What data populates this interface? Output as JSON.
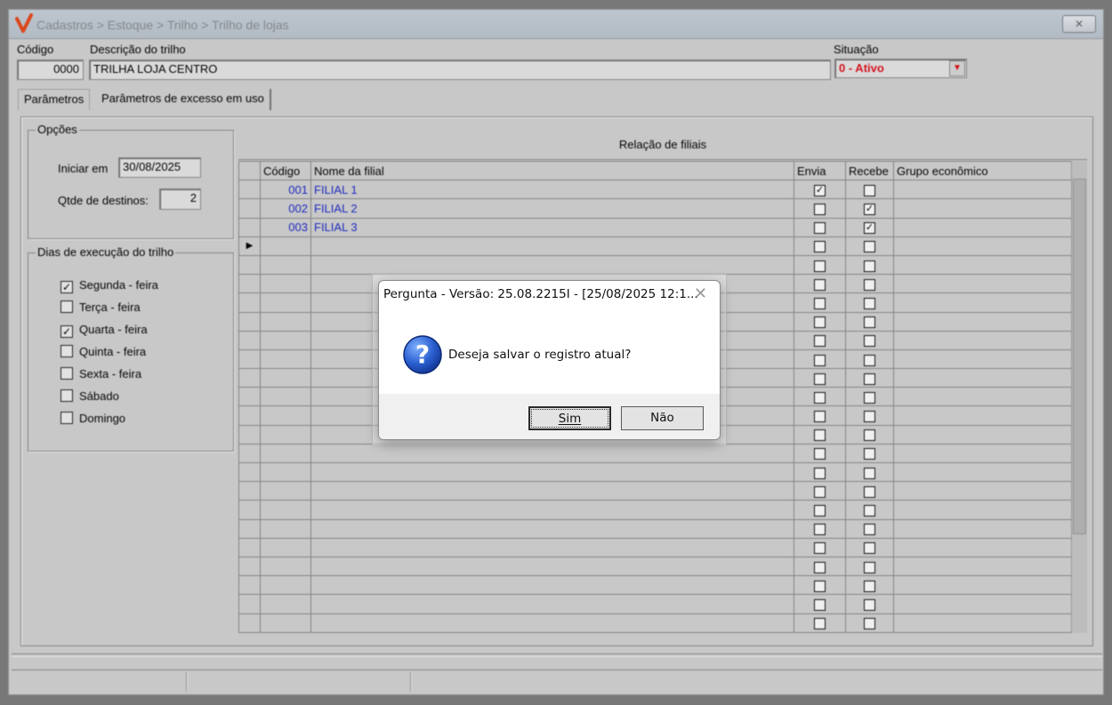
{
  "window": {
    "breadcrumb": "Cadastros > Estoque > Trilho > Trilho de lojas",
    "close_label": "✕"
  },
  "header": {
    "codigo_label": "Código",
    "codigo_value": "0000",
    "descricao_label": "Descrição do trilho",
    "descricao_value": "TRILHA LOJA CENTRO",
    "situacao_label": "Situação",
    "situacao_value": "0 - Ativo"
  },
  "tabs": [
    {
      "label": "Parâmetros"
    },
    {
      "label": "Parâmetros de excesso em uso"
    }
  ],
  "opcoes": {
    "title": "Opções",
    "iniciar_label": "Iniciar em",
    "iniciar_value": "30/08/2025",
    "qtde_label": "Qtde de destinos:",
    "qtde_value": "2"
  },
  "dias": {
    "title": "Dias de execução do trilho",
    "items": [
      {
        "label": "Segunda - feira",
        "checked": true
      },
      {
        "label": "Terça - feira",
        "checked": false
      },
      {
        "label": "Quarta - feira",
        "checked": true
      },
      {
        "label": "Quinta - feira",
        "checked": false
      },
      {
        "label": "Sexta - feira",
        "checked": false
      },
      {
        "label": "Sábado",
        "checked": false
      },
      {
        "label": "Domingo",
        "checked": false
      }
    ]
  },
  "grid": {
    "title": "Relação de filiais",
    "columns": [
      "Código",
      "Nome da filial",
      "Envia",
      "Recebe",
      "Grupo econômico"
    ],
    "rows": [
      {
        "codigo": "001",
        "nome": "FILIAL 1",
        "envia": true,
        "recebe": false,
        "grupo": ""
      },
      {
        "codigo": "002",
        "nome": "FILIAL 2",
        "envia": false,
        "recebe": true,
        "grupo": ""
      },
      {
        "codigo": "003",
        "nome": "FILIAL 3",
        "envia": false,
        "recebe": true,
        "grupo": ""
      }
    ],
    "empty_rows": 21,
    "current_row_marker": "▶"
  },
  "dialog": {
    "title": "Pergunta - Versão: 25.08.2215I - [25/08/2025 12:1...",
    "message": "Deseja salvar o registro atual?",
    "yes_label": "Sim",
    "no_label": "Não",
    "icon": "question-icon"
  },
  "colors": {
    "accent_red": "#e0101a",
    "link_blue": "#1d2ac8",
    "icon_blue": "#1f4fb8"
  }
}
